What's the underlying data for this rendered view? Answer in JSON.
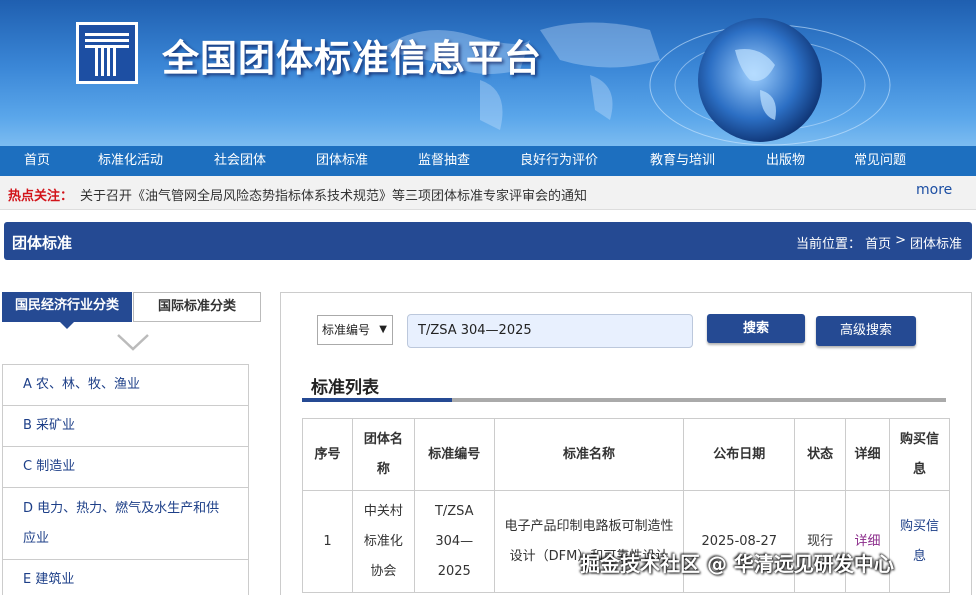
{
  "header": {
    "site_title": "全国团体标准信息平台"
  },
  "nav": {
    "items": [
      "首页",
      "标准化活动",
      "社会团体",
      "团体标准",
      "监督抽查",
      "良好行为评价",
      "教育与培训",
      "出版物",
      "常见问题"
    ]
  },
  "hot": {
    "label": "热点关注：",
    "text": "关于召开《油气管网全局风险态势指标体系技术规范》等三项团体标准专家评审会的通知",
    "more": "more"
  },
  "section": {
    "title": "团体标准",
    "breadcrumb": {
      "prefix": "当前位置：",
      "home": "首页",
      "sep": ">",
      "current": "团体标准"
    }
  },
  "left": {
    "tabs": {
      "active": "国民经济行业分类",
      "inactive": "国际标准分类"
    },
    "categories": [
      "A 农、林、牧、渔业",
      "B 采矿业",
      "C 制造业",
      "D 电力、热力、燃气及水生产和供应业",
      "E 建筑业"
    ]
  },
  "search": {
    "select_value": "标准编号",
    "input_value": "T/ZSA 304—2025",
    "search_label": "搜索",
    "advanced_label": "高级搜索"
  },
  "list": {
    "title": "标准列表",
    "headers": [
      "序号",
      "团体名称",
      "标准编号",
      "标准名称",
      "公布日期",
      "状态",
      "详细",
      "购买信息"
    ],
    "rows": [
      {
        "no": "1",
        "org": "中关村标准化协会",
        "code": "T/ZSA 304—2025",
        "name": "电子产品印制电路板可制造性设计（DFM）和可靠性设计",
        "date": "2025-08-27",
        "status": "现行",
        "detail": "详细",
        "buy": "购买信息"
      }
    ]
  },
  "watermark": "掘金技术社区 @ 华清远见研发中心",
  "colors": {
    "nav_bg": "#1d6fbf",
    "header_bar": "#254a93",
    "hot_label": "#d2141a"
  }
}
